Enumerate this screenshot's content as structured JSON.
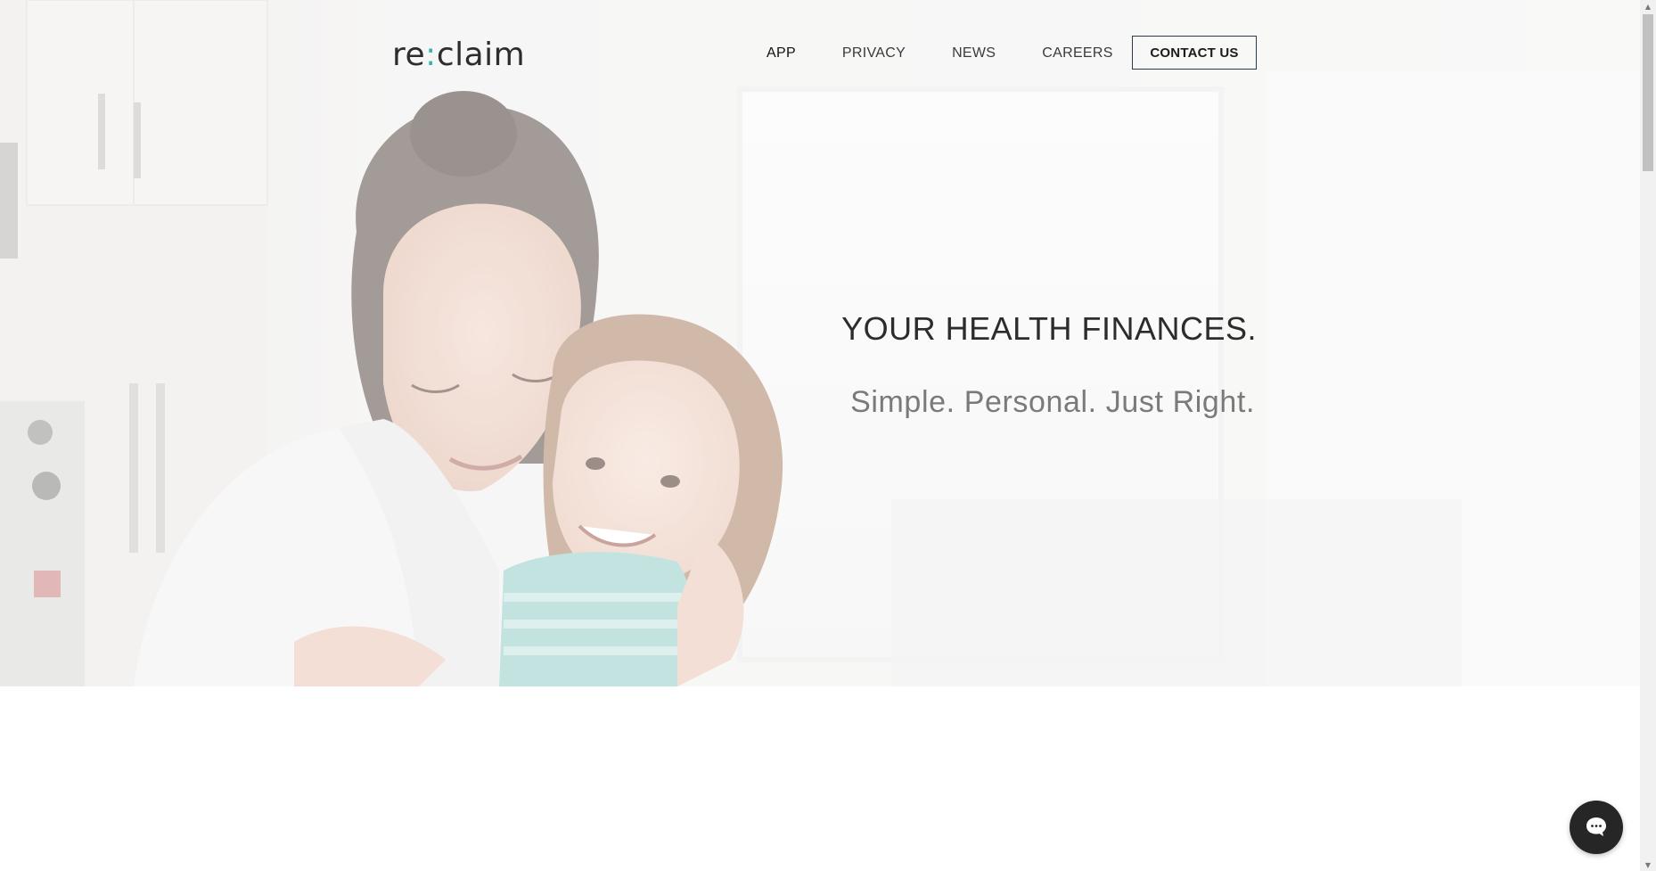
{
  "header": {
    "logo_left": "re",
    "logo_colon": ":",
    "logo_right": "claim",
    "nav": [
      {
        "label": "APP"
      },
      {
        "label": "PRIVACY"
      },
      {
        "label": "NEWS"
      },
      {
        "label": "CAREERS"
      }
    ],
    "contact_label": "CONTACT US"
  },
  "hero": {
    "title": "YOUR HEALTH FINANCES.",
    "subtitle": "Simple. Personal. Just Right."
  },
  "icons": {
    "chat": "chat-bubble-icon",
    "scroll_up": "triangle-up-icon",
    "scroll_down": "triangle-down-icon"
  },
  "colors": {
    "accent": "#2fb6b2",
    "text_dark": "#2c2c2c",
    "text_muted": "#7a7a7a",
    "chat_bg": "#262626"
  }
}
